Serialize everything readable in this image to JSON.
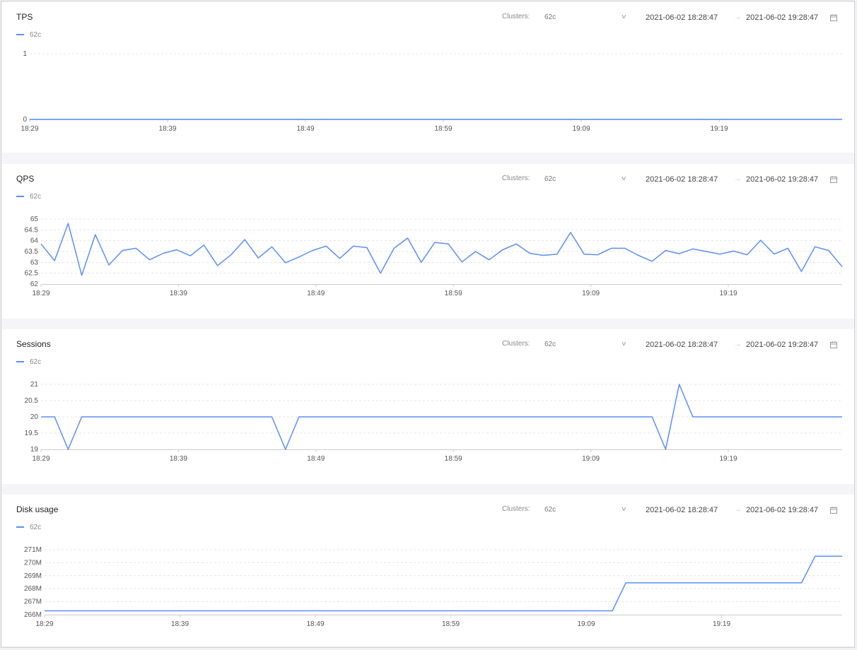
{
  "clusters_label": "Clusters:",
  "date_separator": "→",
  "colors": {
    "series": "#5b8ff9",
    "grid": "#e4e4e4",
    "axis": "#cccccc"
  },
  "icons": {
    "select": "chevron-down-icon",
    "date": "calendar-icon"
  },
  "panels": [
    {
      "title": "TPS",
      "cluster": "62c",
      "date_start": "2021-06-02 18:28:47",
      "date_end": "2021-06-02 19:28:47",
      "legend": "62c"
    },
    {
      "title": "QPS",
      "cluster": "62c",
      "date_start": "2021-06-02 18:28:47",
      "date_end": "2021-06-02 19:28:47",
      "legend": "62c"
    },
    {
      "title": "Sessions",
      "cluster": "62c",
      "date_start": "2021-06-02 18:28:47",
      "date_end": "2021-06-02 19:28:47",
      "legend": "62c"
    },
    {
      "title": "Disk usage",
      "cluster": "62c",
      "date_start": "2021-06-02 18:28:47",
      "date_end": "2021-06-02 19:28:47",
      "legend": "62c"
    }
  ],
  "chart_data": [
    {
      "type": "line",
      "title": "TPS",
      "x": [
        "18:29",
        "18:39",
        "18:49",
        "18:59",
        "19:09",
        "19:19",
        "19:29"
      ],
      "x_ticks": [
        "18:29",
        "18:39",
        "18:49",
        "18:59",
        "19:09",
        "19:19"
      ],
      "y_ticks": [
        "0",
        "1"
      ],
      "ylim": [
        0,
        1
      ],
      "grid": true,
      "legend_position": "top-left",
      "series": [
        {
          "name": "62c",
          "values": [
            0,
            0,
            0,
            0,
            0,
            0,
            0
          ]
        }
      ]
    },
    {
      "type": "line",
      "title": "QPS",
      "x": [
        "18:29",
        "18:30",
        "18:31",
        "18:32",
        "18:33",
        "18:34",
        "18:35",
        "18:36",
        "18:37",
        "18:38",
        "18:39",
        "18:40",
        "18:41",
        "18:42",
        "18:43",
        "18:44",
        "18:45",
        "18:46",
        "18:47",
        "18:48",
        "18:49",
        "18:50",
        "18:51",
        "18:52",
        "18:53",
        "18:54",
        "18:55",
        "18:56",
        "18:57",
        "18:58",
        "18:59",
        "19:00",
        "19:01",
        "19:02",
        "19:03",
        "19:04",
        "19:05",
        "19:06",
        "19:07",
        "19:08",
        "19:09",
        "19:10",
        "19:11",
        "19:12",
        "19:13",
        "19:14",
        "19:15",
        "19:16",
        "19:17",
        "19:18",
        "19:19",
        "19:20",
        "19:21",
        "19:22",
        "19:23",
        "19:24",
        "19:25",
        "19:26",
        "19:27",
        "19:28"
      ],
      "x_ticks": [
        "18:29",
        "18:39",
        "18:49",
        "18:59",
        "19:09",
        "19:19"
      ],
      "y_ticks": [
        "62",
        "62.5",
        "63",
        "63.5",
        "64",
        "64.5",
        "65"
      ],
      "ylim": [
        62,
        65
      ],
      "grid": true,
      "legend_position": "top-left",
      "series": [
        {
          "name": "62c",
          "values": [
            63.85,
            63.08,
            64.8,
            62.4,
            64.28,
            62.88,
            63.55,
            63.65,
            63.12,
            63.42,
            63.58,
            63.3,
            63.8,
            62.85,
            63.35,
            64.05,
            63.2,
            63.72,
            62.98,
            63.25,
            63.55,
            63.75,
            63.18,
            63.75,
            63.68,
            62.5,
            63.65,
            64.12,
            63.0,
            63.92,
            63.85,
            63.02,
            63.5,
            63.12,
            63.58,
            63.85,
            63.42,
            63.32,
            63.38,
            64.38,
            63.38,
            63.35,
            63.65,
            63.65,
            63.32,
            63.05,
            63.55,
            63.4,
            63.62,
            63.5,
            63.38,
            63.52,
            63.35,
            64.02,
            63.38,
            63.65,
            62.58,
            63.72,
            63.55,
            62.8
          ]
        }
      ]
    },
    {
      "type": "line",
      "title": "Sessions",
      "x": [
        "18:29",
        "18:30",
        "18:31",
        "18:32",
        "18:33",
        "18:34",
        "18:35",
        "18:36",
        "18:37",
        "18:38",
        "18:39",
        "18:40",
        "18:41",
        "18:42",
        "18:43",
        "18:44",
        "18:45",
        "18:46",
        "18:47",
        "18:48",
        "18:49",
        "18:50",
        "18:51",
        "18:52",
        "18:53",
        "18:54",
        "18:55",
        "18:56",
        "18:57",
        "18:58",
        "18:59",
        "19:00",
        "19:01",
        "19:02",
        "19:03",
        "19:04",
        "19:05",
        "19:06",
        "19:07",
        "19:08",
        "19:09",
        "19:10",
        "19:11",
        "19:12",
        "19:13",
        "19:14",
        "19:15",
        "19:16",
        "19:17",
        "19:18",
        "19:19",
        "19:20",
        "19:21",
        "19:22",
        "19:23",
        "19:24",
        "19:25",
        "19:26",
        "19:27",
        "19:28"
      ],
      "x_ticks": [
        "18:29",
        "18:39",
        "18:49",
        "18:59",
        "19:09",
        "19:19"
      ],
      "y_ticks": [
        "19",
        "19.5",
        "20",
        "20.5",
        "21"
      ],
      "ylim": [
        19,
        21
      ],
      "grid": true,
      "legend_position": "top-left",
      "series": [
        {
          "name": "62c",
          "values": [
            20,
            20,
            19,
            20,
            20,
            20,
            20,
            20,
            20,
            20,
            20,
            20,
            20,
            20,
            20,
            20,
            20,
            20,
            19,
            20,
            20,
            20,
            20,
            20,
            20,
            20,
            20,
            20,
            20,
            20,
            20,
            20,
            20,
            20,
            20,
            20,
            20,
            20,
            20,
            20,
            20,
            20,
            20,
            20,
            20,
            20,
            19,
            21,
            20,
            20,
            20,
            20,
            20,
            20,
            20,
            20,
            20,
            20,
            20,
            20
          ]
        }
      ]
    },
    {
      "type": "line",
      "title": "Disk usage",
      "x": [
        "18:29",
        "18:30",
        "18:31",
        "18:32",
        "18:33",
        "18:34",
        "18:35",
        "18:36",
        "18:37",
        "18:38",
        "18:39",
        "18:40",
        "18:41",
        "18:42",
        "18:43",
        "18:44",
        "18:45",
        "18:46",
        "18:47",
        "18:48",
        "18:49",
        "18:50",
        "18:51",
        "18:52",
        "18:53",
        "18:54",
        "18:55",
        "18:56",
        "18:57",
        "18:58",
        "18:59",
        "19:00",
        "19:01",
        "19:02",
        "19:03",
        "19:04",
        "19:05",
        "19:06",
        "19:07",
        "19:08",
        "19:09",
        "19:10",
        "19:11",
        "19:12",
        "19:13",
        "19:14",
        "19:15",
        "19:16",
        "19:17",
        "19:18",
        "19:19",
        "19:20",
        "19:21",
        "19:22",
        "19:23",
        "19:24",
        "19:25",
        "19:26",
        "19:27",
        "19:28"
      ],
      "x_ticks": [
        "18:29",
        "18:39",
        "18:49",
        "18:59",
        "19:09",
        "19:19"
      ],
      "y_ticks": [
        "266M",
        "267M",
        "268M",
        "269M",
        "270M",
        "271M"
      ],
      "ylim": [
        266,
        271
      ],
      "y_unit": "M",
      "grid": true,
      "legend_position": "top-left",
      "series": [
        {
          "name": "62c",
          "values": [
            266.3,
            266.3,
            266.3,
            266.3,
            266.3,
            266.3,
            266.3,
            266.3,
            266.3,
            266.3,
            266.3,
            266.3,
            266.3,
            266.3,
            266.3,
            266.3,
            266.3,
            266.3,
            266.3,
            266.3,
            266.3,
            266.3,
            266.3,
            266.3,
            266.3,
            266.3,
            266.3,
            266.3,
            266.3,
            266.3,
            266.3,
            266.3,
            266.3,
            266.3,
            266.3,
            266.3,
            266.3,
            266.3,
            266.3,
            266.3,
            266.3,
            266.3,
            266.3,
            268.45,
            268.45,
            268.45,
            268.45,
            268.45,
            268.45,
            268.45,
            268.45,
            268.45,
            268.45,
            268.45,
            268.45,
            268.45,
            268.45,
            270.5,
            270.5,
            270.5
          ]
        }
      ]
    }
  ]
}
